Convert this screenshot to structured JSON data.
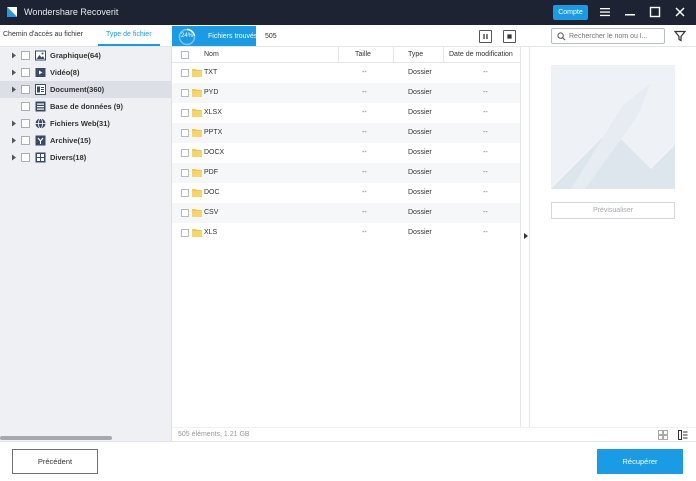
{
  "app": {
    "title": "Wondershare Recoverit"
  },
  "titlebar": {
    "account_label": "Compte"
  },
  "tabs": [
    {
      "label": "Chemin d'accès au fichier",
      "active": false
    },
    {
      "label": "Type de fichier",
      "active": true
    }
  ],
  "scan": {
    "percent": "24%",
    "found_label": "Fichiers trouvés :",
    "found_count": "505"
  },
  "search": {
    "placeholder": "Rechercher le nom ou l..."
  },
  "sidebar": {
    "items": [
      {
        "label": "Graphique(64)",
        "icon": "image-icon"
      },
      {
        "label": "Vidéo(8)",
        "icon": "video-icon"
      },
      {
        "label": "Document(360)",
        "icon": "document-icon",
        "selected": true
      },
      {
        "label": "Base de données (9)",
        "icon": "database-icon"
      },
      {
        "label": "Fichiers Web(31)",
        "icon": "globe-icon"
      },
      {
        "label": "Archive(15)",
        "icon": "archive-icon"
      },
      {
        "label": "Divers(18)",
        "icon": "misc-icon"
      }
    ]
  },
  "list": {
    "columns": {
      "name": "Nom",
      "size": "Taille",
      "type": "Type",
      "date": "Date de modification"
    },
    "rows": [
      {
        "name": "TXT",
        "size": "--",
        "type": "Dossier",
        "date": "--"
      },
      {
        "name": "PYD",
        "size": "--",
        "type": "Dossier",
        "date": "--"
      },
      {
        "name": "XLSX",
        "size": "--",
        "type": "Dossier",
        "date": "--"
      },
      {
        "name": "PPTX",
        "size": "--",
        "type": "Dossier",
        "date": "--"
      },
      {
        "name": "DOCX",
        "size": "--",
        "type": "Dossier",
        "date": "--"
      },
      {
        "name": "PDF",
        "size": "--",
        "type": "Dossier",
        "date": "--"
      },
      {
        "name": "DOC",
        "size": "--",
        "type": "Dossier",
        "date": "--"
      },
      {
        "name": "CSV",
        "size": "--",
        "type": "Dossier",
        "date": "--"
      },
      {
        "name": "XLS",
        "size": "--",
        "type": "Dossier",
        "date": "--"
      }
    ]
  },
  "status": {
    "summary": "505 éléments, 1.21 GB"
  },
  "preview": {
    "button_label": "Prévisualiser"
  },
  "footer": {
    "back_label": "Précédent",
    "recover_label": "Récupérer"
  },
  "colors": {
    "accent": "#1a9be6",
    "titlebar": "#1d2332",
    "sidebar": "#eef0f3"
  }
}
